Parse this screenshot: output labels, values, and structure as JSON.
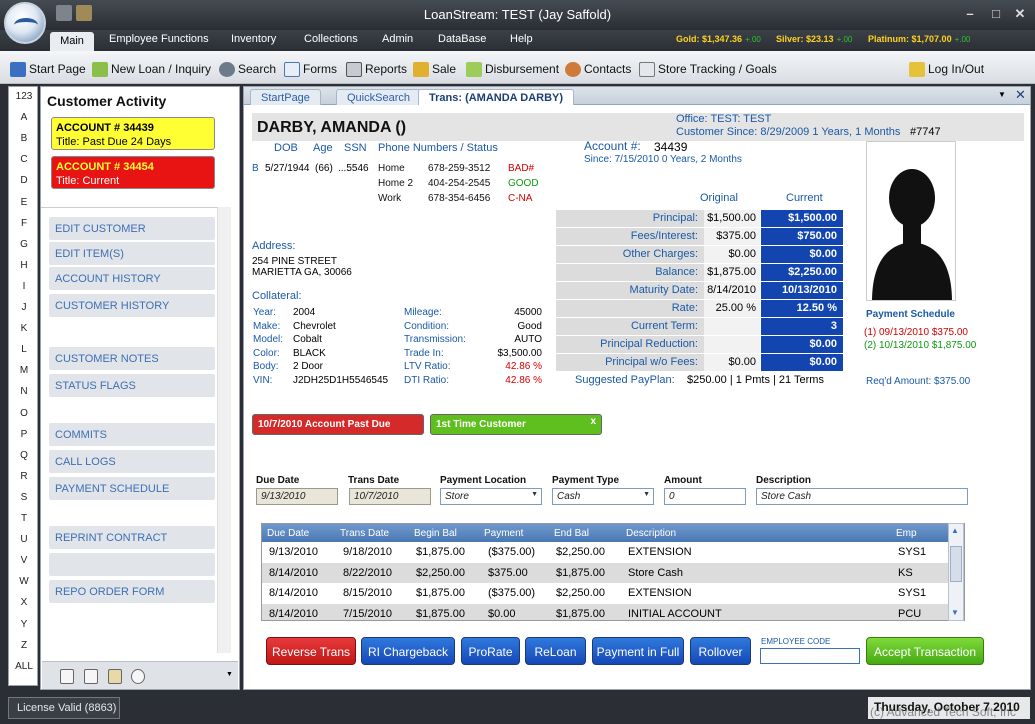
{
  "window": {
    "title": "LoanStream: TEST (Jay Saffold)"
  },
  "menu": {
    "items": [
      "Main",
      "Employee Functions",
      "Inventory",
      "Collections",
      "Admin",
      "DataBase",
      "Help"
    ]
  },
  "ticker": {
    "gold_label": "Gold:",
    "gold_value": "$1,347.36",
    "gold_change": "+.00",
    "silver_label": "Silver:",
    "silver_value": "$23.13",
    "silver_change": "+.00",
    "platinum_label": "Platinum:",
    "platinum_value": "$1,707.00",
    "platinum_change": "+.00"
  },
  "toolbar": {
    "start": "Start Page",
    "newloan": "New Loan / Inquiry",
    "search": "Search",
    "forms": "Forms",
    "reports": "Reports",
    "sale": "Sale",
    "disbursement": "Disbursement",
    "contacts": "Contacts",
    "tracking": "Store Tracking / Goals",
    "login": "Log In/Out"
  },
  "letters": [
    "123",
    "A",
    "B",
    "C",
    "D",
    "E",
    "F",
    "G",
    "H",
    "I",
    "J",
    "K",
    "L",
    "M",
    "N",
    "O",
    "P",
    "Q",
    "R",
    "S",
    "T",
    "U",
    "V",
    "W",
    "X",
    "Y",
    "Z",
    "ALL"
  ],
  "activity": {
    "title": "Customer Activity",
    "acct1_num": "ACCOUNT # 34439",
    "acct1_title": "Title: Past Due 24 Days",
    "acct2_num": "ACCOUNT # 34454",
    "acct2_title": "Title: Current",
    "buttons": [
      "EDIT CUSTOMER",
      "EDIT ITEM(S)",
      "ACCOUNT HISTORY",
      "CUSTOMER HISTORY",
      "CUSTOMER NOTES",
      "STATUS FLAGS",
      "COMMITS",
      "CALL LOGS",
      "PAYMENT SCHEDULE",
      "REPRINT CONTRACT",
      "",
      "REPO ORDER FORM"
    ]
  },
  "tabs": {
    "t1": "StartPage",
    "t2": "QuickSearch",
    "t3": "Trans: (AMANDA DARBY)"
  },
  "customer": {
    "name": "DARBY, AMANDA ()",
    "office": "Office: TEST: TEST",
    "since": "Customer Since: 8/29/2009 1 Years, 1 Months",
    "custno": "#7747",
    "dob_h": "DOB",
    "age_h": "Age",
    "ssn_h": "SSN",
    "phone_h": "Phone Numbers / Status",
    "b": "B",
    "dob": "5/27/1944",
    "age": "(66)",
    "ssn": "...5546",
    "phones": [
      {
        "type": "Home",
        "num": "678-259-3512",
        "status": "BAD#"
      },
      {
        "type": "Home 2",
        "num": "404-254-2545",
        "status": "GOOD"
      },
      {
        "type": "Work",
        "num": "678-354-6456",
        "status": "C-NA"
      }
    ],
    "address_h": "Address:",
    "addr1": "254 PINE STREET",
    "addr2": "MARIETTA GA, 30066"
  },
  "account": {
    "label": "Account #:",
    "num": "34439",
    "since": "Since: 7/15/2010 0 Years, 2 Months",
    "orig_h": "Original",
    "cur_h": "Current",
    "rows": [
      {
        "label": "Principal:",
        "orig": "$1,500.00",
        "cur": "$1,500.00"
      },
      {
        "label": "Fees/Interest:",
        "orig": "$375.00",
        "cur": "$750.00"
      },
      {
        "label": "Other Charges:",
        "orig": "$0.00",
        "cur": "$0.00"
      },
      {
        "label": "Balance:",
        "orig": "$1,875.00",
        "cur": "$2,250.00"
      },
      {
        "label": "Maturity Date:",
        "orig": "8/14/2010",
        "cur": "10/13/2010"
      },
      {
        "label": "Rate:",
        "orig": "25.00 %",
        "cur": "12.50 %"
      },
      {
        "label": "Current Term:",
        "orig": "",
        "cur": "3"
      },
      {
        "label": "Principal Reduction:",
        "orig": "",
        "cur": "$0.00"
      },
      {
        "label": "Principal w/o Fees:",
        "orig": "$0.00",
        "cur": "$0.00"
      }
    ],
    "payplan_label": "Suggested PayPlan:",
    "payplan": "$250.00 | 1 Pmts | 21 Terms"
  },
  "schedule": {
    "title": "Payment Schedule",
    "line1": "(1) 09/13/2010 $375.00",
    "line2": "(2) 10/13/2010 $1,875.00",
    "reqd": "Req'd Amount: $375.00"
  },
  "collateral": {
    "title": "Collateral:",
    "left": [
      {
        "k": "Year:",
        "v": "2004"
      },
      {
        "k": "Make:",
        "v": "Chevrolet"
      },
      {
        "k": "Model:",
        "v": "Cobalt"
      },
      {
        "k": "Color:",
        "v": "BLACK"
      },
      {
        "k": "Body:",
        "v": "2 Door"
      },
      {
        "k": "VIN:",
        "v": "J2DH25D1H5546545"
      }
    ],
    "right": [
      {
        "k": "Mileage:",
        "v": "45000"
      },
      {
        "k": "Condition:",
        "v": "Good"
      },
      {
        "k": "Transmission:",
        "v": "AUTO"
      },
      {
        "k": "Trade In:",
        "v": "$3,500.00"
      },
      {
        "k": "LTV Ratio:",
        "v": "42.86 %"
      },
      {
        "k": "DTI Ratio:",
        "v": "42.86 %"
      }
    ]
  },
  "badges": {
    "pastdue": "10/7/2010 Account Past Due",
    "first": "1st Time Customer",
    "close": "x"
  },
  "entry": {
    "due_h": "Due Date",
    "trans_h": "Trans Date",
    "loc_h": "Payment Location",
    "type_h": "Payment Type",
    "amt_h": "Amount",
    "desc_h": "Description",
    "due": "9/13/2010",
    "trans": "10/7/2010",
    "loc": "Store",
    "type": "Cash",
    "amt": "0",
    "desc": "Store Cash"
  },
  "grid": {
    "headers": [
      "Due Date",
      "Trans Date",
      "Begin Bal",
      "Payment",
      "End Bal",
      "Description",
      "Emp"
    ],
    "rows": [
      [
        "9/13/2010",
        "9/18/2010",
        "$1,875.00",
        "($375.00)",
        "$2,250.00",
        "EXTENSION",
        "SYS1"
      ],
      [
        "8/14/2010",
        "8/22/2010",
        "$2,250.00",
        "$375.00",
        "$1,875.00",
        "Store Cash",
        "KS"
      ],
      [
        "8/14/2010",
        "8/15/2010",
        "$1,875.00",
        "($375.00)",
        "$2,250.00",
        "EXTENSION",
        "SYS1"
      ],
      [
        "8/14/2010",
        "7/15/2010",
        "$1,875.00",
        "$0.00",
        "$1,875.00",
        "INITIAL ACCOUNT",
        "PCU"
      ]
    ]
  },
  "actions": {
    "reverse": "Reverse Trans",
    "chargeback": "RI Chargeback",
    "prorate": "ProRate",
    "reloan": "ReLoan",
    "payfull": "Payment in Full",
    "rollover": "Rollover",
    "empcode": "EMPLOYEE CODE",
    "accept": "Accept Transaction"
  },
  "status": {
    "license": "License Valid (8863)",
    "date": "Thursday, October 7 2010",
    "watermark": "(c) Advanced Tech Soft, Inc"
  },
  "colors": {
    "accent": "#1a5aa6",
    "ledger_current": "#1345b0",
    "past_due_red": "#d40000",
    "good_green": "#119911"
  }
}
